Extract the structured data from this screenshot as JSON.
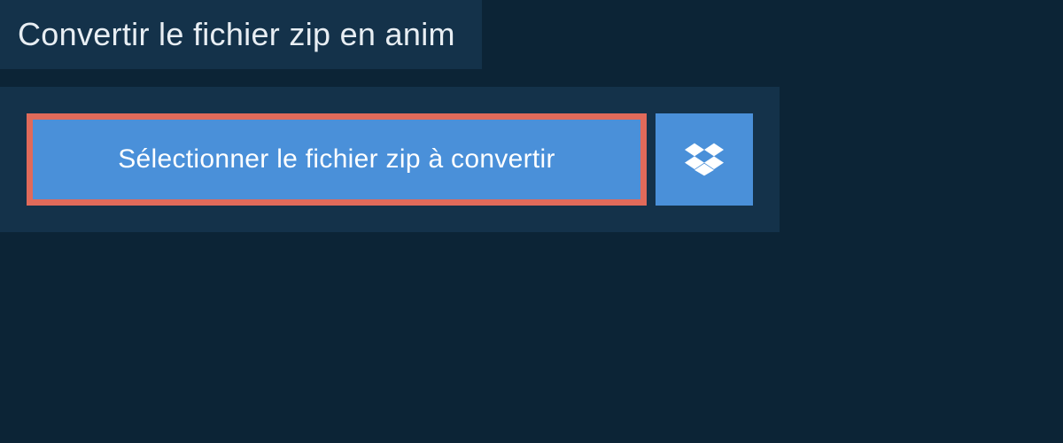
{
  "header": {
    "title": "Convertir le fichier zip en anim"
  },
  "actions": {
    "select_file_label": "Sélectionner le fichier zip à convertir",
    "dropbox_icon": "dropbox-icon"
  },
  "colors": {
    "page_bg": "#0c2436",
    "panel_bg": "#14324a",
    "button_bg": "#4a90d9",
    "highlight_border": "#e06a5a",
    "text_light": "#e8eef3",
    "text_white": "#ffffff"
  }
}
